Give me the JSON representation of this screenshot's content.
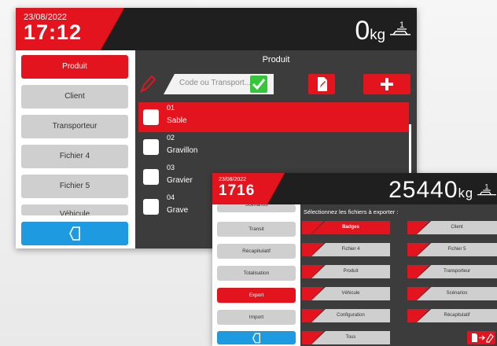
{
  "products_screen": {
    "date": "23/08/2022",
    "time": "17:12",
    "weight_value": "0",
    "weight_unit": "kg",
    "sidebar": [
      {
        "label": "Produit",
        "active": true
      },
      {
        "label": "Client",
        "active": false
      },
      {
        "label": "Transporteur",
        "active": false
      },
      {
        "label": "Fichier 4",
        "active": false
      },
      {
        "label": "Fichier 5",
        "active": false
      },
      {
        "label": "Véhicule",
        "active": false
      }
    ],
    "panel_title": "Produit",
    "search_placeholder": "Code ou Transport...",
    "rows": [
      {
        "code": "01",
        "name": "Sable",
        "active": true
      },
      {
        "code": "02",
        "name": "Gravillon",
        "active": false
      },
      {
        "code": "03",
        "name": "Gravier",
        "active": false
      },
      {
        "code": "04",
        "name": "Grave",
        "active": false
      }
    ]
  },
  "export_screen": {
    "date": "23/08/2022",
    "time": "1716",
    "weight_value": "25440",
    "weight_unit": "kg",
    "sidebar": [
      {
        "label": "Scénarios",
        "active": false
      },
      {
        "label": "Transit",
        "active": false
      },
      {
        "label": "Récapitulatif",
        "active": false
      },
      {
        "label": "Totalisation",
        "active": false
      },
      {
        "label": "Export",
        "active": true
      },
      {
        "label": "Import",
        "active": false
      }
    ],
    "title": "Sélectionnez les fichiers à exporter :",
    "files": [
      {
        "label": "Badges",
        "selected": true
      },
      {
        "label": "Client",
        "selected": false
      },
      {
        "label": "Fichier 4",
        "selected": false
      },
      {
        "label": "Fichier 5",
        "selected": false
      },
      {
        "label": "Produit",
        "selected": false
      },
      {
        "label": "Transporteur",
        "selected": false
      },
      {
        "label": "Véhicule",
        "selected": false
      },
      {
        "label": "Scénarios",
        "selected": false
      },
      {
        "label": "Configuration",
        "selected": false
      },
      {
        "label": "Récapitulatif",
        "selected": false
      },
      {
        "label": "Tous",
        "selected": false
      }
    ]
  },
  "colors": {
    "accent": "#e3141d",
    "back": "#1e9be0",
    "confirm": "#35c63a",
    "panel": "#3c3c3c",
    "topbar": "#1f1f1f"
  }
}
